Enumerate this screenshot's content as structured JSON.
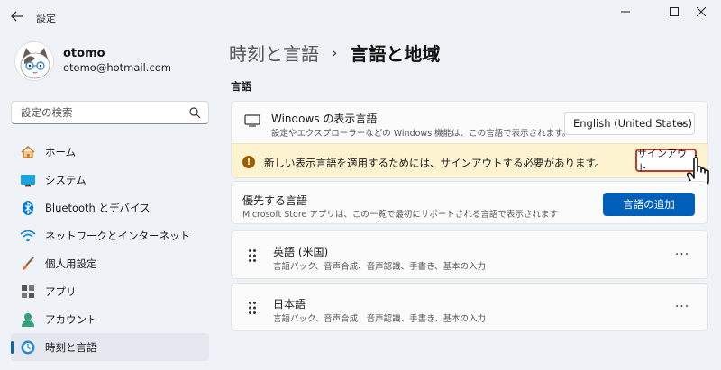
{
  "window": {
    "title": "設定"
  },
  "profile": {
    "name": "otomo",
    "email": "otomo@hotmail.com"
  },
  "search": {
    "placeholder": "設定の検索"
  },
  "sidebar": {
    "items": [
      {
        "label": "ホーム",
        "icon": "home-icon"
      },
      {
        "label": "システム",
        "icon": "system-icon"
      },
      {
        "label": "Bluetooth とデバイス",
        "icon": "bluetooth-icon"
      },
      {
        "label": "ネットワークとインターネット",
        "icon": "network-icon"
      },
      {
        "label": "個人用設定",
        "icon": "brush-icon"
      },
      {
        "label": "アプリ",
        "icon": "apps-icon"
      },
      {
        "label": "アカウント",
        "icon": "account-icon"
      },
      {
        "label": "時刻と言語",
        "icon": "time-language-icon",
        "active": true
      }
    ]
  },
  "breadcrumb": {
    "parent": "時刻と言語",
    "separator": "›",
    "current": "言語と地域"
  },
  "section": {
    "heading": "言語"
  },
  "display_language": {
    "title": "Windows の表示言語",
    "description": "設定やエクスプローラーなどの Windows 機能は、この言語で表示されます。",
    "selected": "English (United States)"
  },
  "warning": {
    "text": "新しい表示言語を適用するためには、サインアウトする必要があります。",
    "button": "サインアウト"
  },
  "preferred": {
    "title": "優先する言語",
    "description": "Microsoft Store アプリは、この一覧で最初にサポートされる言語で表示されます",
    "add_button": "言語の追加"
  },
  "languages": [
    {
      "name": "英語 (米国)",
      "features": "言語パック、音声合成、音声認識、手書き、基本の入力"
    },
    {
      "name": "日本語",
      "features": "言語パック、音声合成、音声認識、手書き、基本の入力"
    }
  ],
  "more_label": "···",
  "colors": {
    "accent": "#005fb8",
    "warning_bg": "#fdf3d1",
    "highlight_border": "#c0392b"
  }
}
